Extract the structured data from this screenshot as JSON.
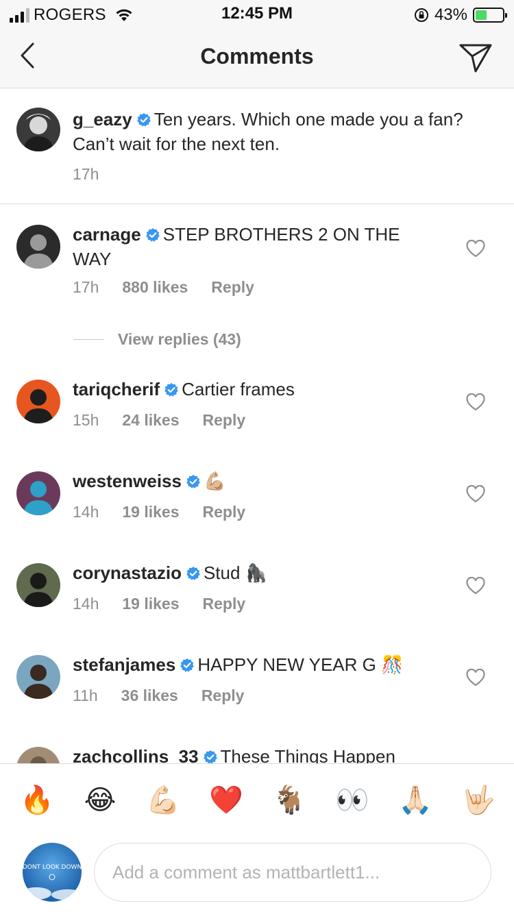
{
  "status_bar": {
    "carrier": "ROGERS",
    "time": "12:45 PM",
    "battery": "43%",
    "battery_level": 0.43
  },
  "header": {
    "title": "Comments",
    "back_icon": "chevron-left-icon",
    "send_icon": "paper-plane-icon"
  },
  "caption": {
    "username": "g_eazy",
    "text": "Ten years. Which one made you a fan? Can’t wait for the next ten.",
    "time": "17h"
  },
  "comments": [
    {
      "username": "carnage",
      "text": "STEP BROTHERS 2 ON THE WAY",
      "time": "17h",
      "likes": "880 likes",
      "reply": "Reply",
      "view_replies": "View replies (43)"
    },
    {
      "username": "tariqcherif",
      "text": "Cartier frames",
      "time": "15h",
      "likes": "24 likes",
      "reply": "Reply"
    },
    {
      "username": "westenweiss",
      "text": "💪🏼",
      "time": "14h",
      "likes": "19 likes",
      "reply": "Reply"
    },
    {
      "username": "corynastazio",
      "text": "Stud 🦍",
      "time": "14h",
      "likes": "19 likes",
      "reply": "Reply"
    },
    {
      "username": "stefanjames",
      "text": "HAPPY NEW YEAR G 🎊",
      "time": "11h",
      "likes": "36 likes",
      "reply": "Reply"
    },
    {
      "username": "zachcollins_33",
      "text": "These Things Happen"
    }
  ],
  "reactions": [
    "🔥",
    "😂",
    "💪🏻",
    "❤️",
    "🐐",
    "👀",
    "🙏🏻",
    "🤟🏻"
  ],
  "composer": {
    "placeholder": "Add a comment as mattbartlett1...",
    "avatar_text": "DONT LOOK DOWN"
  },
  "colors": {
    "verified": "#3897f0",
    "secondary_text": "#8e8e8e",
    "primary_text": "#262626",
    "divider": "#dbdbdb",
    "header_bg": "#f7f7f7"
  }
}
